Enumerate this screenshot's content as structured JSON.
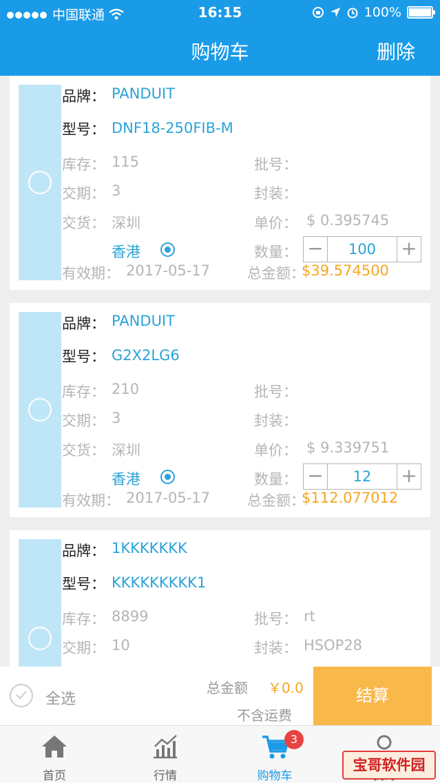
{
  "status_bar": {
    "carrier": "中国联通",
    "time": "16:15",
    "battery": "100%"
  },
  "nav": {
    "title": "购物车",
    "delete_label": "删除"
  },
  "labels": {
    "brand": "品牌：",
    "model": "型号：",
    "stock": "库存：",
    "lead_time": "交期：",
    "delivery": "交货：",
    "batch": "批号：",
    "package": "封装：",
    "unit_price": "单价：",
    "quantity": "数量：",
    "valid": "有效期：",
    "total": "总金额：",
    "minus": "−",
    "plus": "+"
  },
  "items": [
    {
      "brand": "PANDUIT",
      "model": "DNF18-250FIB-M",
      "stock": "115",
      "lead_time": "3",
      "delivery_1": "深圳",
      "delivery_2": "香港",
      "batch": "",
      "package": "",
      "unit_price": "$ 0.395745",
      "quantity": "100",
      "valid": "2017-05-17",
      "total": "$39.574500"
    },
    {
      "brand": "PANDUIT",
      "model": "G2X2LG6",
      "stock": "210",
      "lead_time": "3",
      "delivery_1": "深圳",
      "delivery_2": "香港",
      "batch": "",
      "package": "",
      "unit_price": "$ 9.339751",
      "quantity": "12",
      "valid": "2017-05-17",
      "total": "$112.077012"
    },
    {
      "brand": "1KKKKKKK",
      "model": "KKKKKKKKK1",
      "stock": "8899",
      "lead_time": "10",
      "batch": "rt",
      "package": "HSOP28"
    }
  ],
  "summary": {
    "select_all": "全选",
    "total_label": "总金额",
    "total_value": "￥0.0",
    "shipping_note": "不含运费",
    "checkout": "结算"
  },
  "tabs": [
    {
      "label": "首页",
      "icon": "home-icon"
    },
    {
      "label": "行情",
      "icon": "chart-icon"
    },
    {
      "label": "购物车",
      "icon": "cart-icon",
      "badge": "3"
    },
    {
      "label": "我的",
      "icon": "user-icon"
    }
  ],
  "watermark": "宝哥软件园",
  "colors": {
    "primary": "#1a9be8",
    "accent": "#2aa3d9",
    "price": "#f5a623",
    "checkout": "#f9b84a"
  }
}
